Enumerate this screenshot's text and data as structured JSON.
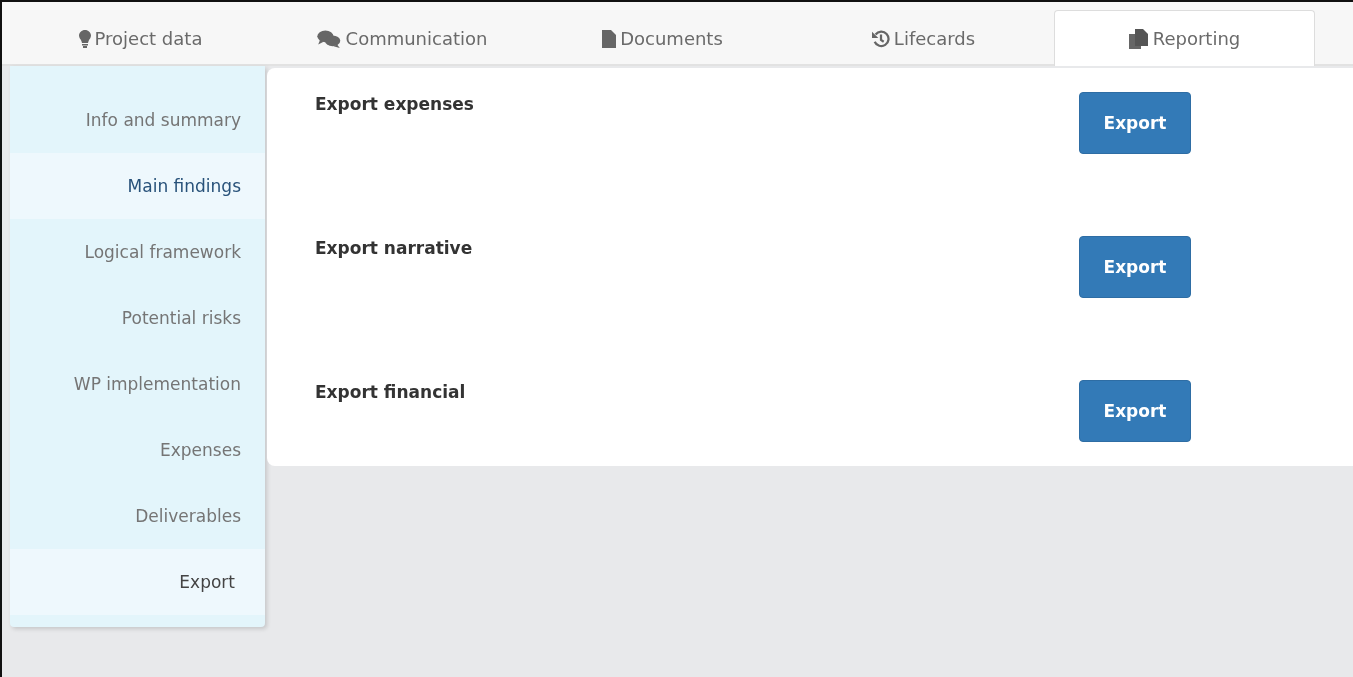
{
  "tabs": [
    {
      "label": "Project data",
      "selected": false
    },
    {
      "label": "Communication",
      "selected": false
    },
    {
      "label": "Documents",
      "selected": false
    },
    {
      "label": "Lifecards",
      "selected": false
    },
    {
      "label": "Reporting",
      "selected": true
    }
  ],
  "sidebar": {
    "items": [
      {
        "label": "Info and summary",
        "selected": false,
        "hovered": false
      },
      {
        "label": "Main findings",
        "selected": false,
        "hovered": true
      },
      {
        "label": "Logical framework",
        "selected": false,
        "hovered": false
      },
      {
        "label": "Potential risks",
        "selected": false,
        "hovered": false
      },
      {
        "label": "WP implementation",
        "selected": false,
        "hovered": false
      },
      {
        "label": "Expenses",
        "selected": false,
        "hovered": false
      },
      {
        "label": "Deliverables",
        "selected": false,
        "hovered": false
      },
      {
        "label": "Export",
        "selected": true,
        "hovered": false
      }
    ]
  },
  "exports": [
    {
      "label": "Export expenses",
      "button": "Export"
    },
    {
      "label": "Export narrative",
      "button": "Export"
    },
    {
      "label": "Export financial",
      "button": "Export"
    }
  ]
}
